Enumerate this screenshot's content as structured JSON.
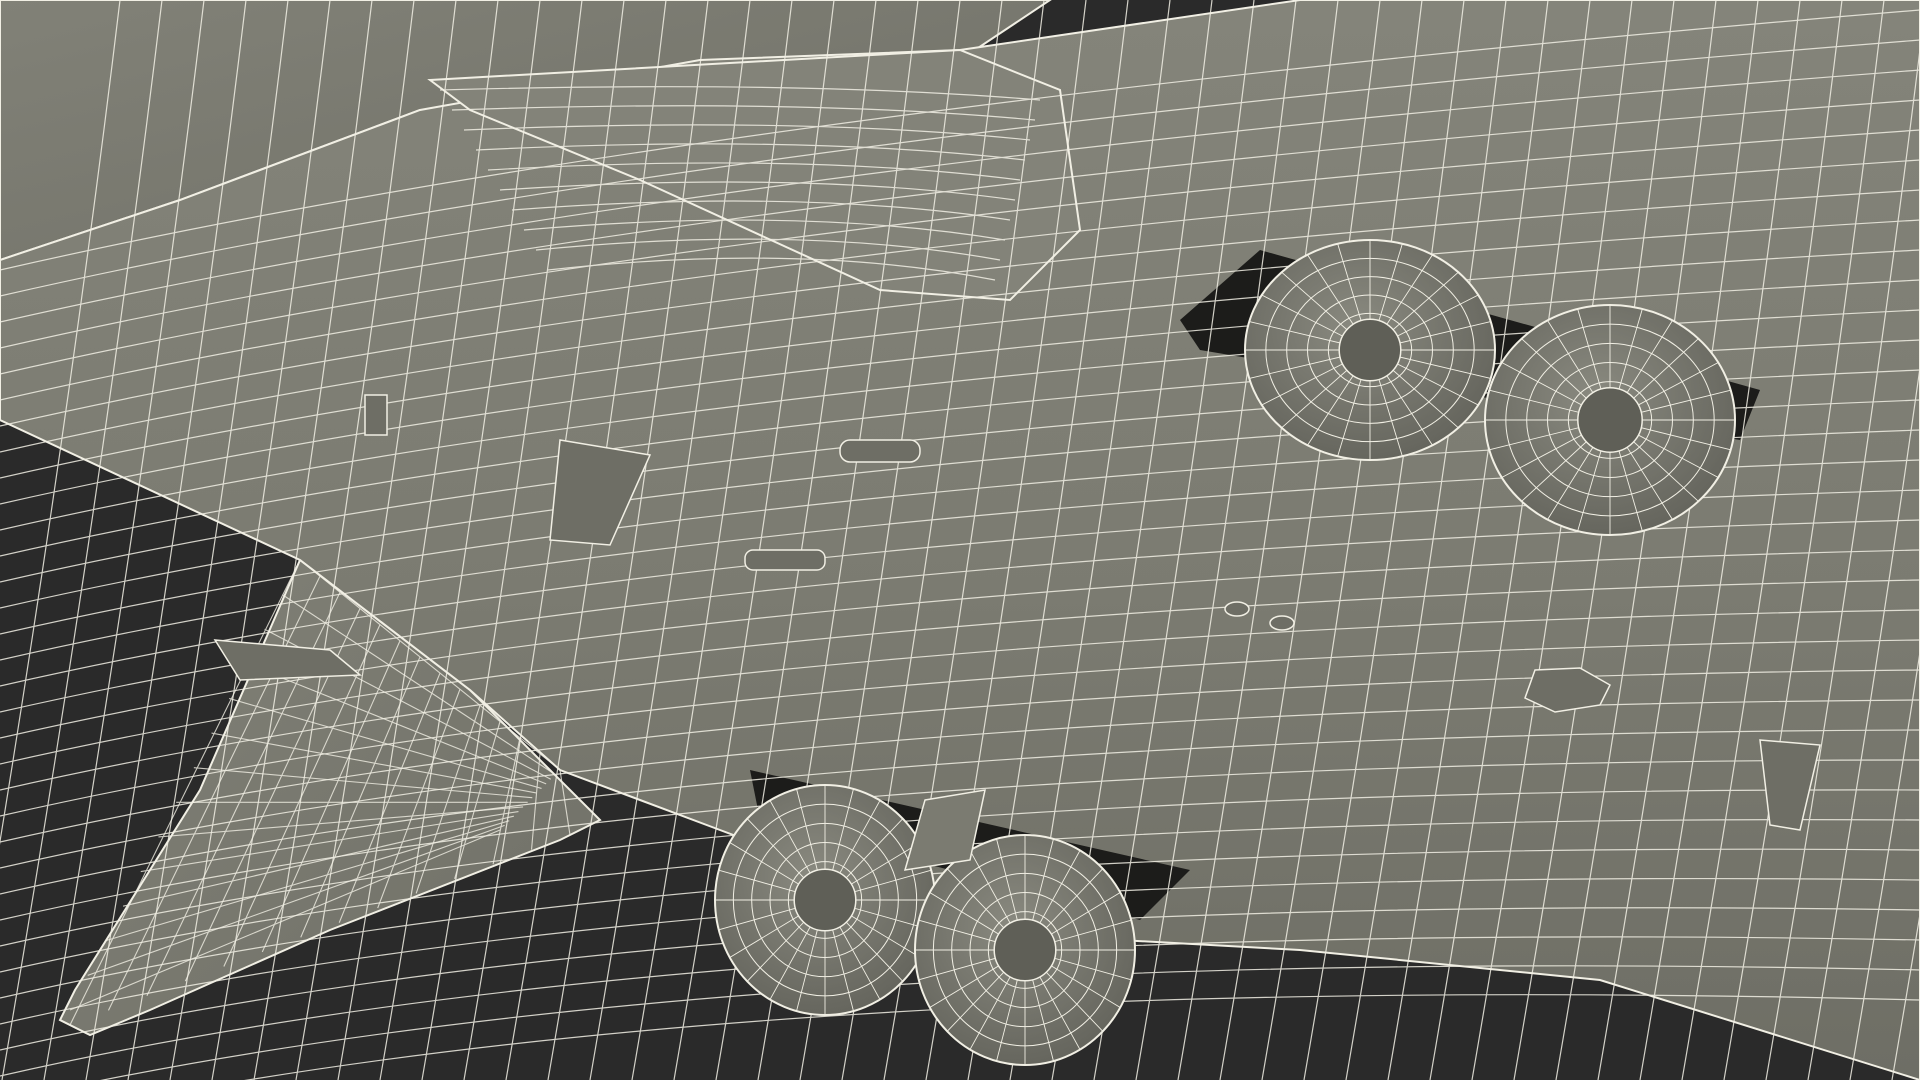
{
  "scene": {
    "subject": "wireframe-render-aircraft-underside",
    "colors": {
      "background": "#2a2a2a",
      "surface": "#7c7c72",
      "surface_light": "#8a8a80",
      "surface_dark": "#5f5f57",
      "shadow": "#1c1c1a",
      "wire": "#f1efe4",
      "tire": "#77776e"
    }
  }
}
